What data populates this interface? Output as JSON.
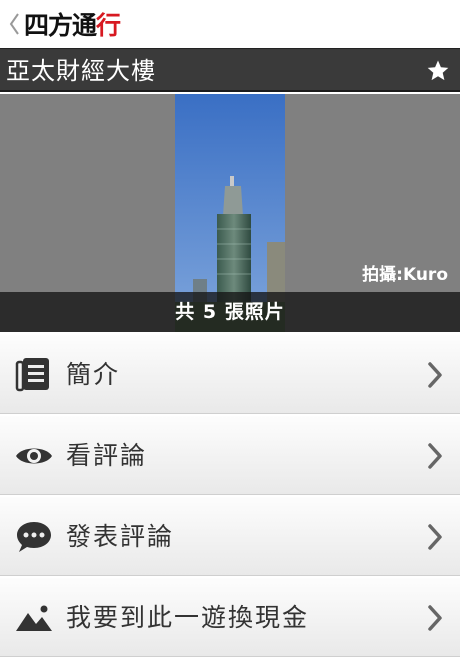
{
  "header": {
    "logo_main": "四方通",
    "logo_accent": "行"
  },
  "titlebar": {
    "title": "亞太財經大樓"
  },
  "photo": {
    "credit": "拍攝:Kuro",
    "count_text": "共 5 張照片"
  },
  "menu": {
    "items": [
      {
        "label": "簡介",
        "icon": "document-list-icon"
      },
      {
        "label": "看評論",
        "icon": "eye-icon"
      },
      {
        "label": "發表評論",
        "icon": "speech-bubble-icon"
      },
      {
        "label": "我要到此一遊換現金",
        "icon": "landscape-image-icon"
      }
    ]
  },
  "colors": {
    "titlebar_bg": "#3a3a3a",
    "photo_bg": "#808080",
    "logo_accent": "#d71921",
    "menu_text": "#333333"
  }
}
